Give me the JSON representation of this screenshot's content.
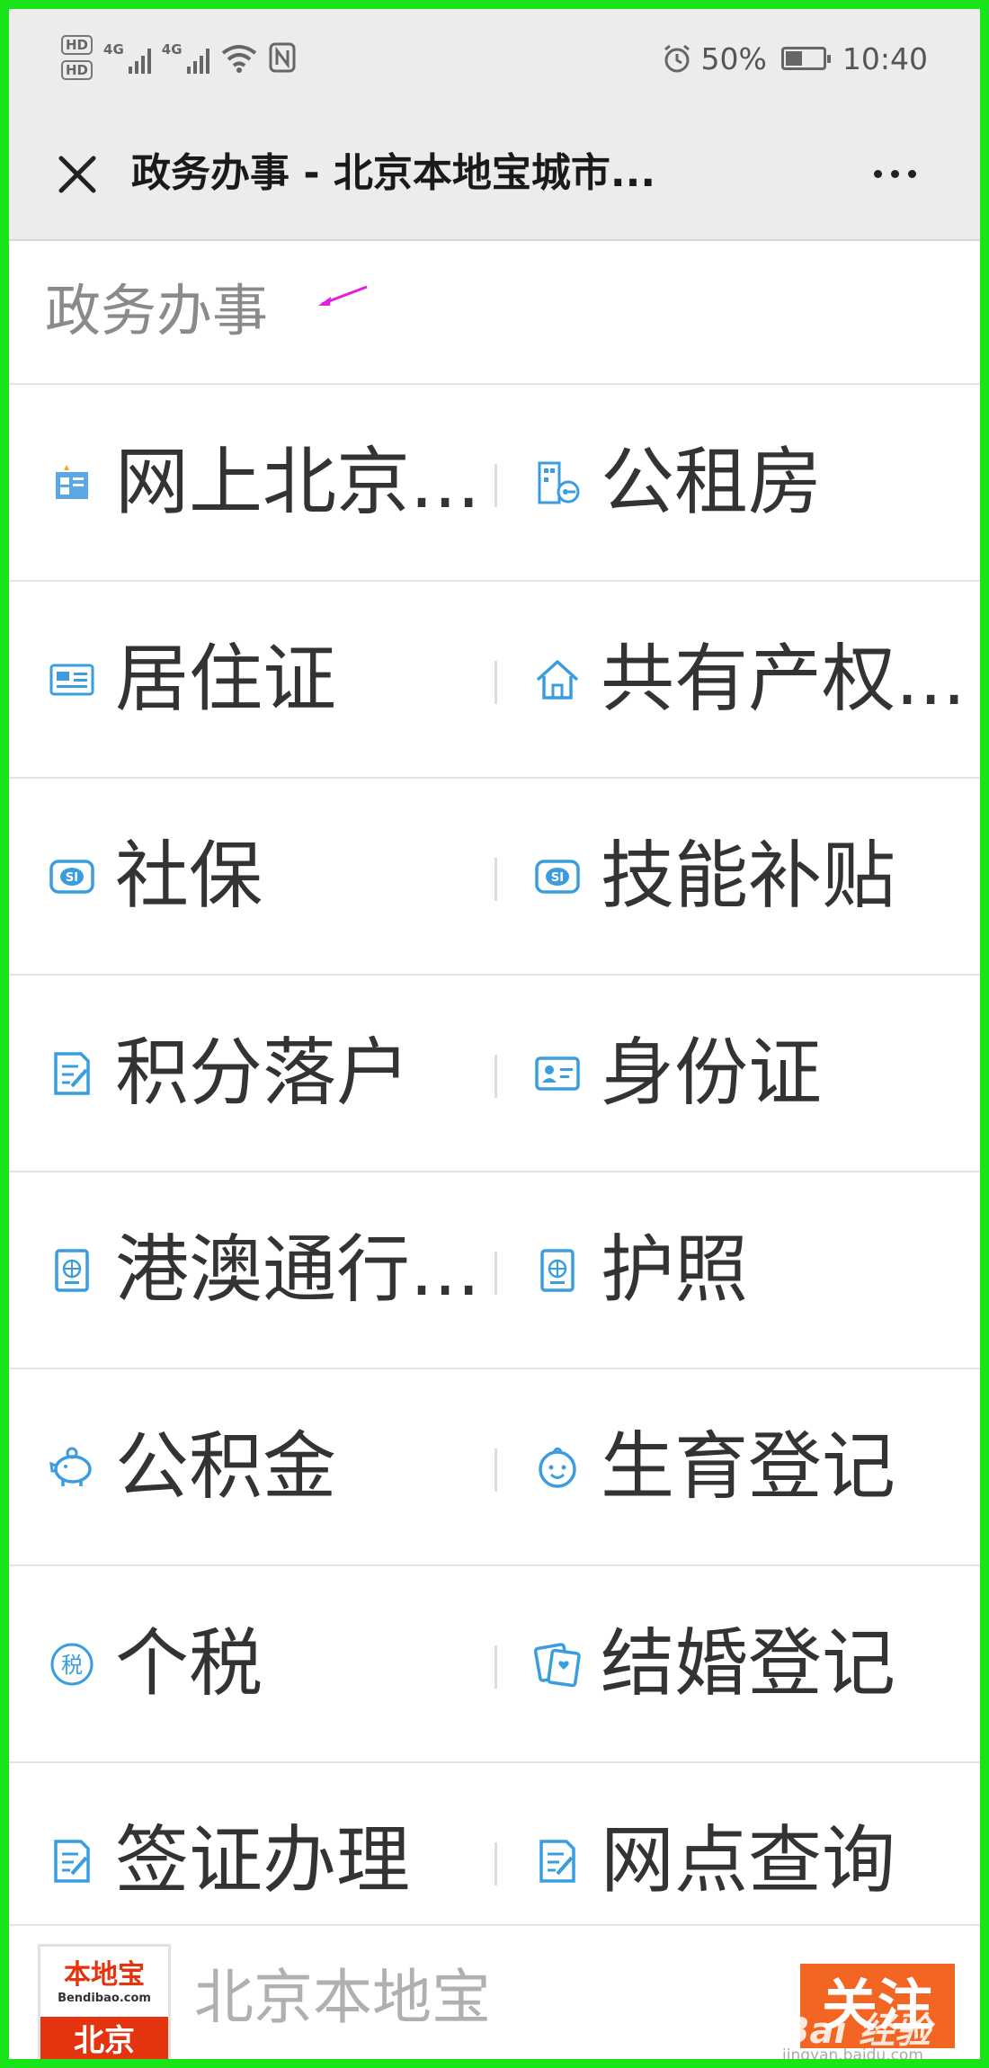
{
  "status_bar": {
    "hd1": "HD",
    "hd2": "HD",
    "net1": "4G",
    "net2": "4G",
    "battery_text": "50%",
    "battery_level": 0.5,
    "time": "10:40"
  },
  "nav": {
    "title": "政务办事 - 北京本地宝城市..."
  },
  "section": {
    "title": "政务办事"
  },
  "services": [
    {
      "left": {
        "label": "网上北京...",
        "icon": "building-card-icon"
      },
      "right": {
        "label": "公租房",
        "icon": "house-key-icon"
      }
    },
    {
      "left": {
        "label": "居住证",
        "icon": "residence-card-icon"
      },
      "right": {
        "label": "共有产权...",
        "icon": "house-icon"
      }
    },
    {
      "left": {
        "label": "社保",
        "icon": "social-security-icon"
      },
      "right": {
        "label": "技能补贴",
        "icon": "social-security-icon"
      }
    },
    {
      "left": {
        "label": "积分落户",
        "icon": "document-edit-icon"
      },
      "right": {
        "label": "身份证",
        "icon": "id-card-icon"
      }
    },
    {
      "left": {
        "label": "港澳通行...",
        "icon": "passport-icon"
      },
      "right": {
        "label": "护照",
        "icon": "passport-icon"
      }
    },
    {
      "left": {
        "label": "公积金",
        "icon": "piggy-bank-icon"
      },
      "right": {
        "label": "生育登记",
        "icon": "baby-face-icon"
      }
    },
    {
      "left": {
        "label": "个税",
        "icon": "tax-icon"
      },
      "right": {
        "label": "结婚登记",
        "icon": "marriage-certificate-icon"
      }
    },
    {
      "left": {
        "label": "签证办理",
        "icon": "document-edit-icon"
      },
      "right": {
        "label": "网点查询",
        "icon": "document-edit-icon"
      }
    }
  ],
  "footer": {
    "logo_top": "本地宝",
    "logo_sub": "Bendibao.com",
    "logo_city": "北京",
    "account_name": "北京本地宝",
    "follow_label": "关注",
    "watermark": "Bai 经验",
    "watermark_url": "jingyan.baidu.com"
  },
  "colors": {
    "frame": "#19e319",
    "icon_blue": "#3a9de0",
    "follow_orange": "#f26522",
    "logo_red": "#e4330f"
  }
}
